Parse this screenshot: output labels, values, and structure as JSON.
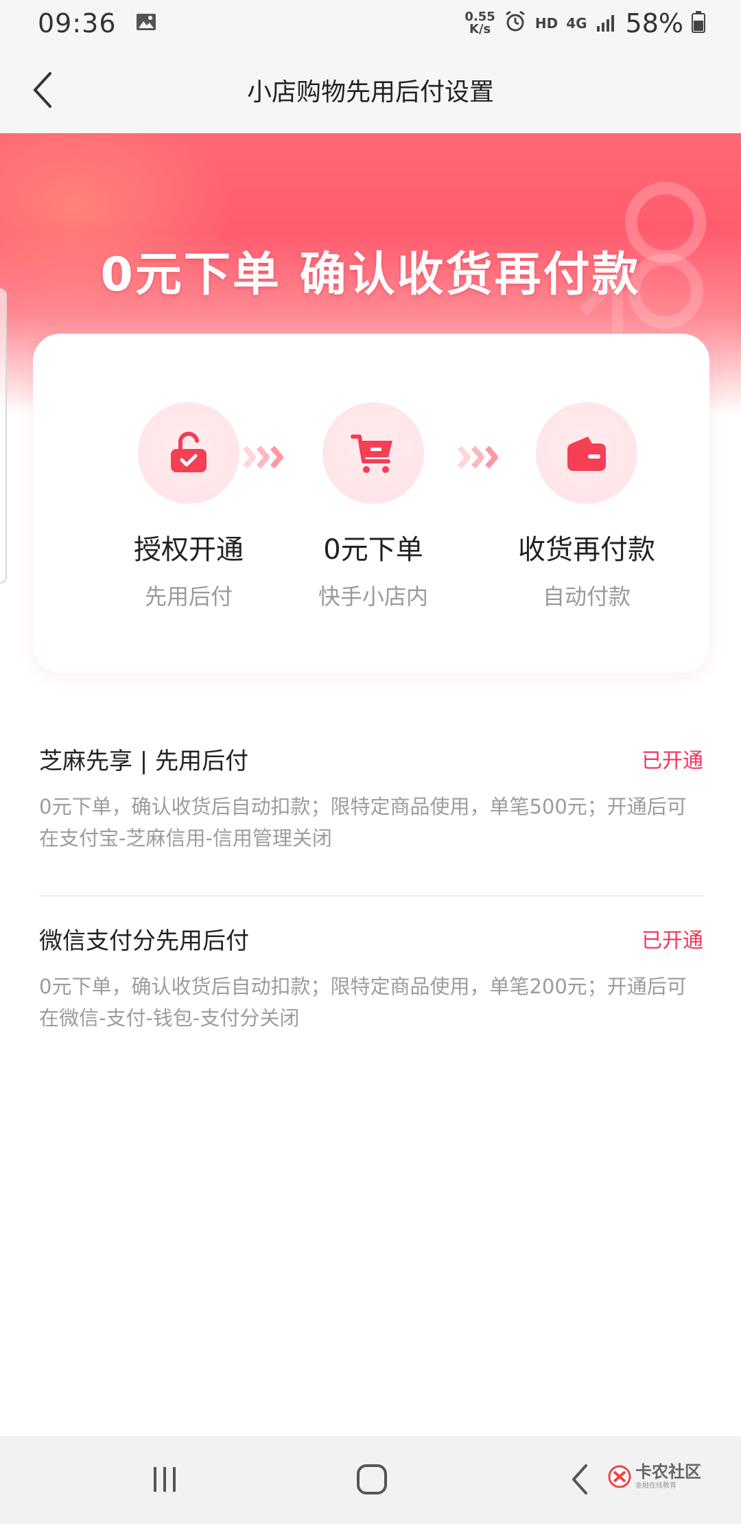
{
  "status_bar": {
    "time": "09:36",
    "net_speed_value": "0.55",
    "net_speed_unit": "K/s",
    "hd": "HD",
    "network": "4G",
    "battery": "58%",
    "icons": [
      "image-icon",
      "alarm-icon",
      "signal-icon",
      "battery-icon"
    ]
  },
  "header": {
    "title": "小店购物先用后付设置",
    "back_icon": "chevron-left-icon"
  },
  "banner": {
    "headline": "0元下单  确认收货再付款"
  },
  "steps": [
    {
      "icon": "unlock-icon",
      "title": "授权开通",
      "subtitle": "先用后付"
    },
    {
      "icon": "cart-icon",
      "title": "0元下单",
      "subtitle": "快手小店内"
    },
    {
      "icon": "wallet-icon",
      "title": "收货再付款",
      "subtitle": "自动付款"
    }
  ],
  "sections": [
    {
      "title": "芝麻先享 | 先用后付",
      "status": "已开通",
      "description": "0元下单，确认收货后自动扣款；限特定商品使用，单笔500元；开通后可在支付宝-芝麻信用-信用管理关闭"
    },
    {
      "title": "微信支付分先用后付",
      "status": "已开通",
      "description": "0元下单，确认收货后自动扣款；限特定商品使用，单笔200元；开通后可在微信-支付-钱包-支付分关闭"
    }
  ],
  "nav_bar": {
    "watermark_main": "卡农社区",
    "watermark_sub": "金融在线教育"
  },
  "colors": {
    "accent": "#f0375b",
    "banner_top": "#ff5c6e",
    "icon_red": "#f43f55",
    "icon_bg": "#ffe6e9"
  }
}
